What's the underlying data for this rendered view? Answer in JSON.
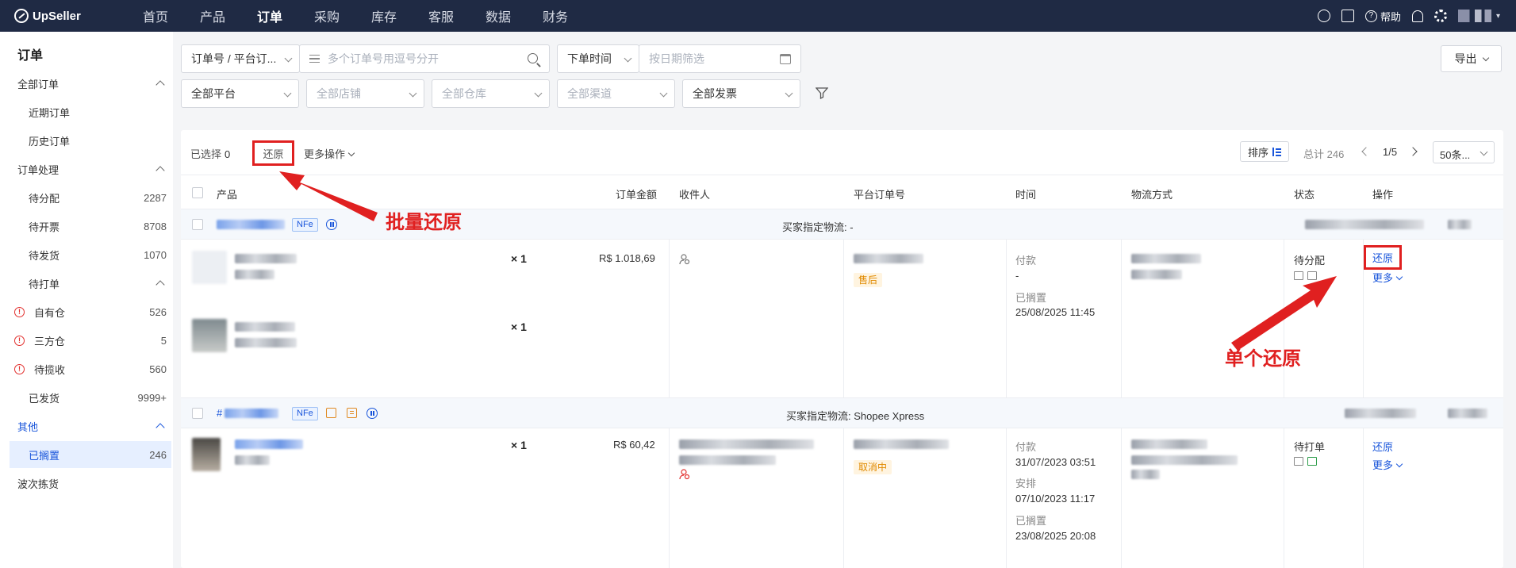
{
  "app": {
    "logo_text": "UpSeller",
    "nav": [
      "首页",
      "产品",
      "订单",
      "采购",
      "库存",
      "客服",
      "数据",
      "财务"
    ],
    "nav_active": "订单",
    "help_label": "帮助",
    "icons": [
      "globe-icon",
      "apps-icon",
      "help-icon",
      "bell-icon",
      "gear-icon"
    ]
  },
  "sidebar": {
    "title": "订单",
    "items": [
      {
        "label": "全部订单",
        "type": "group"
      },
      {
        "label": "近期订单",
        "type": "sub"
      },
      {
        "label": "历史订单",
        "type": "sub"
      },
      {
        "label": "订单处理",
        "type": "group"
      },
      {
        "label": "待分配",
        "type": "sub",
        "count": "2287"
      },
      {
        "label": "待开票",
        "type": "sub",
        "count": "8708"
      },
      {
        "label": "待发货",
        "type": "sub",
        "count": "1070"
      },
      {
        "label": "待打单",
        "type": "subgroup"
      },
      {
        "label": "自有仓",
        "type": "warn",
        "count": "526"
      },
      {
        "label": "三方仓",
        "type": "warn",
        "count": "5"
      },
      {
        "label": "待揽收",
        "type": "warn",
        "count": "560"
      },
      {
        "label": "已发货",
        "type": "sub",
        "count": "9999+"
      },
      {
        "label": "其他",
        "type": "group-blue"
      },
      {
        "label": "已搁置",
        "type": "active",
        "count": "246"
      },
      {
        "label": "波次拣货",
        "type": "group"
      }
    ]
  },
  "filters": {
    "order_type": "订单号 / 平台订...",
    "order_search_placeholder": "多个订单号用逗号分开",
    "time_type": "下单时间",
    "date_placeholder": "按日期筛选",
    "platform": "全部平台",
    "store_placeholder": "全部店铺",
    "warehouse_placeholder": "全部仓库",
    "channel_placeholder": "全部渠道",
    "invoice": "全部发票",
    "export_label": "导出"
  },
  "toolbar": {
    "selected_label": "已选择",
    "selected_count": "0",
    "restore_label": "还原",
    "more_label": "更多操作",
    "sort_label": "排序",
    "total_label": "总计 246",
    "page_label": "1/5",
    "page_size": "50条..."
  },
  "table": {
    "headers": [
      "产品",
      "订单金额",
      "收件人",
      "平台订单号",
      "时间",
      "物流方式",
      "状态",
      "操作"
    ]
  },
  "orders": [
    {
      "nfe": "NFe",
      "buyer_logistics": "买家指定物流: -",
      "products": [
        {
          "qty": "× 1"
        },
        {
          "qty": "× 1"
        }
      ],
      "amount": "R$ 1.018,69",
      "tag": "售后",
      "times": [
        {
          "label": "付款",
          "value": "-"
        },
        {
          "label": "已搁置",
          "value": "25/08/2025 11:45"
        }
      ],
      "status": "待分配",
      "action_restore": "还原",
      "action_more": "更多"
    },
    {
      "hash": "#",
      "nfe": "NFe",
      "buyer_logistics": "买家指定物流: Shopee Xpress",
      "products": [
        {
          "qty": "× 1"
        }
      ],
      "amount": "R$ 60,42",
      "tag": "取消中",
      "times": [
        {
          "label": "付款",
          "value": "31/07/2023 03:51"
        },
        {
          "label": "安排",
          "value": "07/10/2023 11:17"
        },
        {
          "label": "已搁置",
          "value": "23/08/2025 20:08"
        }
      ],
      "status": "待打单",
      "action_restore": "还原",
      "action_more": "更多"
    }
  ],
  "annotations": {
    "batch": "批量还原",
    "single": "单个还原",
    "color": "#e02020"
  }
}
